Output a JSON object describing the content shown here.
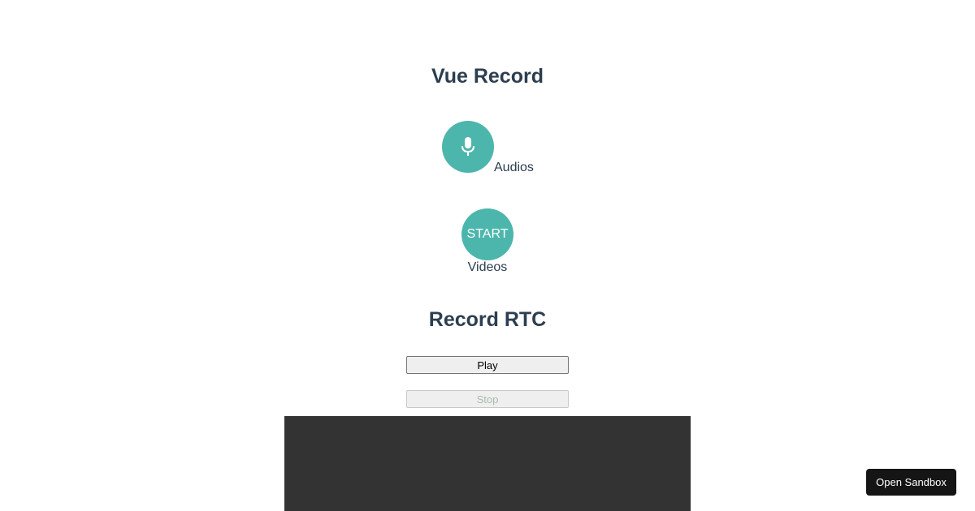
{
  "vue_record": {
    "title": "Vue Record",
    "audio": {
      "icon": "microphone-icon",
      "label": "Audios"
    },
    "video": {
      "start_label": "START",
      "label": "Videos"
    }
  },
  "record_rtc": {
    "title": "Record RTC",
    "play_label": "Play",
    "stop_label": "Stop"
  },
  "sandbox": {
    "open_label": "Open Sandbox"
  },
  "colors": {
    "accent": "#4db6ac",
    "heading": "#2c3e50",
    "video_bg": "#333333",
    "sandbox_bg": "#151515"
  }
}
